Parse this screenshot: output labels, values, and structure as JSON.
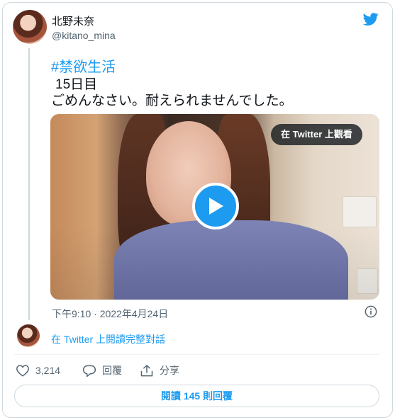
{
  "author": {
    "display_name": "北野未奈",
    "handle": "@kitano_mina"
  },
  "tweet": {
    "hashtag": "#禁欲生活",
    "line1": "15日目",
    "line2": "ごめんなさい。耐えられませんでした。",
    "timestamp": "下午9:10 · 2022年4月24日"
  },
  "video": {
    "watch_on_twitter": "在 Twitter 上觀看"
  },
  "conversation_link": "在 Twitter 上閱讀完整對話",
  "actions": {
    "likes": "3,214",
    "reply": "回覆",
    "share": "分享"
  },
  "read_replies": "閱讀 145 則回覆",
  "icons": [
    "twitter-bird-icon",
    "play-icon",
    "info-icon",
    "heart-icon",
    "reply-icon",
    "share-icon"
  ],
  "colors": {
    "accent": "#1d9bf0",
    "secondary_text": "#536471",
    "border": "#cfd9de"
  }
}
